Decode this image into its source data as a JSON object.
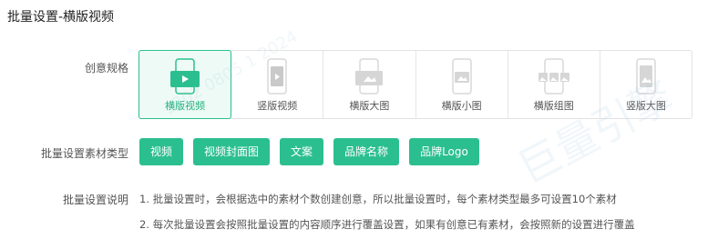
{
  "page": {
    "title": "批量设置-横版视频"
  },
  "creative_spec": {
    "label": "创意规格",
    "items": [
      {
        "label": "横版视频",
        "icon": "landscape-video-icon",
        "active": true
      },
      {
        "label": "竖版视频",
        "icon": "portrait-video-icon",
        "active": false
      },
      {
        "label": "横版大图",
        "icon": "landscape-large-image-icon",
        "active": false
      },
      {
        "label": "横版小图",
        "icon": "landscape-small-image-icon",
        "active": false
      },
      {
        "label": "横版组图",
        "icon": "landscape-group-image-icon",
        "active": false
      },
      {
        "label": "竖版大图",
        "icon": "portrait-large-image-icon",
        "active": false
      }
    ]
  },
  "material_types": {
    "label": "批量设置素材类型",
    "buttons": [
      "视频",
      "视频封面图",
      "文案",
      "品牌名称",
      "品牌Logo"
    ]
  },
  "description": {
    "label": "批量设置说明",
    "lines": [
      "1. 批量设置时，会根据选中的素材个数创建创意，所以批量设置时，每个素材类型最多可设置10个素材",
      "2. 每次批量设置会按照批量设置的内容顺序进行覆盖设置，如果有创意已有素材，会按照新的设置进行覆盖"
    ]
  },
  "watermark": {
    "text": "巨量引擎",
    "subtext": "1302 0805 1 2024"
  },
  "colors": {
    "accent": "#2bbf8f",
    "active_bg": "#eefaf5",
    "text": "#555555",
    "title": "#222222"
  }
}
